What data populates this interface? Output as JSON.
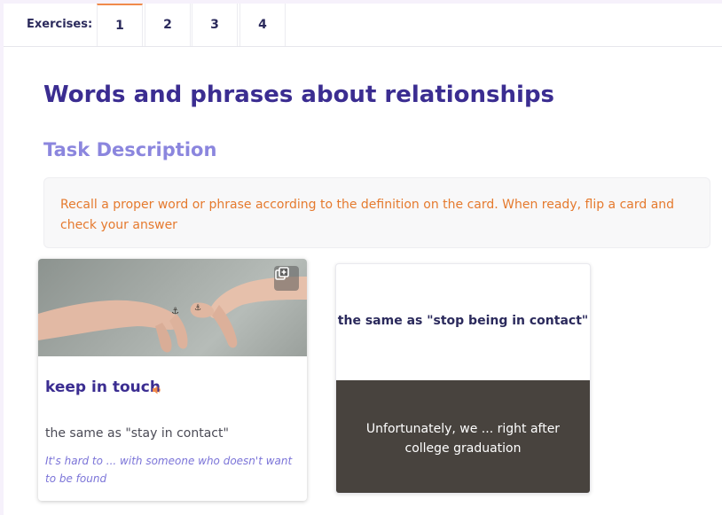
{
  "tabs": {
    "label": "Exercises:",
    "items": [
      {
        "label": "1",
        "active": true
      },
      {
        "label": "2",
        "active": false
      },
      {
        "label": "3",
        "active": false
      },
      {
        "label": "4",
        "active": false
      }
    ]
  },
  "main": {
    "title": "Words and phrases about relationships",
    "task_heading": "Task Description",
    "task_text": "Recall a proper word or phrase according to the definition on the card. When ready, flip a card and check your answer"
  },
  "cards": [
    {
      "word": "keep in touch",
      "definition": "the same as \"stay in contact\"",
      "example": "It's hard to ... with someone who doesn't want to be found",
      "image": "hands-pinky-promise-photo",
      "icons": [
        "copy-icon",
        "speaker-icon"
      ]
    },
    {
      "definition": "the same as \"stop being in contact\"",
      "example": "Unfortunately, we ... right after college graduation"
    }
  ],
  "colors": {
    "title": "#3b2d91",
    "subtitle": "#8b86de",
    "task_text": "#e57a2e",
    "active_tab": "#f08a4b",
    "card_back": "#48433e",
    "example_italic": "#7b74d8"
  }
}
